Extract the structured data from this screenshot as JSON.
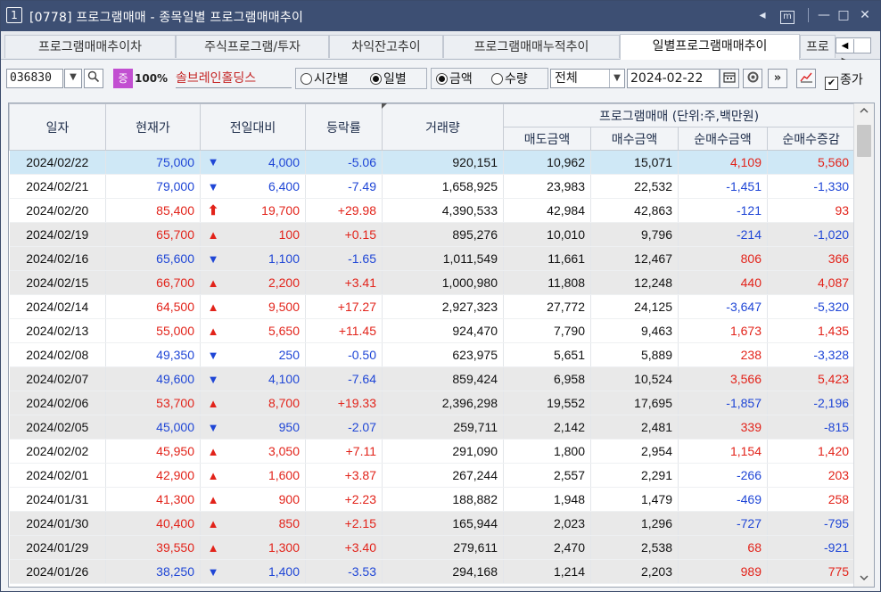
{
  "window": {
    "number": "1",
    "title": "[0778] 프로그램매매 - 종목일별 프로그램매매추이",
    "controls": {
      "left": "◂",
      "m": "m",
      "min": "—",
      "max": "□",
      "close": "✕"
    }
  },
  "tabs": [
    {
      "label": "프로그램매매추이차"
    },
    {
      "label": "주식프로그램/투자"
    },
    {
      "label": "차익잔고추이"
    },
    {
      "label": "프로그램매매누적추이"
    },
    {
      "label": "일별프로그램매매추이"
    },
    {
      "label": "프로"
    }
  ],
  "toolbar": {
    "code": "036830",
    "badge": "증",
    "margin": "100%",
    "stock_name": "솔브레인홀딩스",
    "radio_time": "시간별",
    "radio_day": "일별",
    "radio_amount": "금액",
    "radio_qty": "수량",
    "filter_value": "전체",
    "date": "2024-02-22",
    "chk_label": "종가"
  },
  "table": {
    "headers": {
      "date": "일자",
      "price": "현재가",
      "change": "전일대비",
      "rate": "등락률",
      "volume": "거래량",
      "group": "프로그램매매 (단위:주,백만원)",
      "sell": "매도금액",
      "buy": "매수금액",
      "net": "순매수금액",
      "net_chg": "순매수증감"
    },
    "rows": [
      {
        "date": "2024/02/22",
        "price": "75,000",
        "dir": "down",
        "change": "4,000",
        "rate": "-5.06",
        "volume": "920,151",
        "sell": "10,962",
        "buy": "15,071",
        "net": "4,109",
        "net_chg": "5,560"
      },
      {
        "date": "2024/02/21",
        "price": "79,000",
        "dir": "down",
        "change": "6,400",
        "rate": "-7.49",
        "volume": "1,658,925",
        "sell": "23,983",
        "buy": "22,532",
        "net": "-1,451",
        "net_chg": "-1,330"
      },
      {
        "date": "2024/02/20",
        "price": "85,400",
        "dir": "limit",
        "change": "19,700",
        "rate": "+29.98",
        "volume": "4,390,533",
        "sell": "42,984",
        "buy": "42,863",
        "net": "-121",
        "net_chg": "93"
      },
      {
        "date": "2024/02/19",
        "price": "65,700",
        "dir": "up",
        "change": "100",
        "rate": "+0.15",
        "volume": "895,276",
        "sell": "10,010",
        "buy": "9,796",
        "net": "-214",
        "net_chg": "-1,020"
      },
      {
        "date": "2024/02/16",
        "price": "65,600",
        "dir": "down",
        "change": "1,100",
        "rate": "-1.65",
        "volume": "1,011,549",
        "sell": "11,661",
        "buy": "12,467",
        "net": "806",
        "net_chg": "366"
      },
      {
        "date": "2024/02/15",
        "price": "66,700",
        "dir": "up",
        "change": "2,200",
        "rate": "+3.41",
        "volume": "1,000,980",
        "sell": "11,808",
        "buy": "12,248",
        "net": "440",
        "net_chg": "4,087"
      },
      {
        "date": "2024/02/14",
        "price": "64,500",
        "dir": "up",
        "change": "9,500",
        "rate": "+17.27",
        "volume": "2,927,323",
        "sell": "27,772",
        "buy": "24,125",
        "net": "-3,647",
        "net_chg": "-5,320"
      },
      {
        "date": "2024/02/13",
        "price": "55,000",
        "dir": "up",
        "change": "5,650",
        "rate": "+11.45",
        "volume": "924,470",
        "sell": "7,790",
        "buy": "9,463",
        "net": "1,673",
        "net_chg": "1,435"
      },
      {
        "date": "2024/02/08",
        "price": "49,350",
        "dir": "down",
        "change": "250",
        "rate": "-0.50",
        "volume": "623,975",
        "sell": "5,651",
        "buy": "5,889",
        "net": "238",
        "net_chg": "-3,328"
      },
      {
        "date": "2024/02/07",
        "price": "49,600",
        "dir": "down",
        "change": "4,100",
        "rate": "-7.64",
        "volume": "859,424",
        "sell": "6,958",
        "buy": "10,524",
        "net": "3,566",
        "net_chg": "5,423"
      },
      {
        "date": "2024/02/06",
        "price": "53,700",
        "dir": "up",
        "change": "8,700",
        "rate": "+19.33",
        "volume": "2,396,298",
        "sell": "19,552",
        "buy": "17,695",
        "net": "-1,857",
        "net_chg": "-2,196"
      },
      {
        "date": "2024/02/05",
        "price": "45,000",
        "dir": "down",
        "change": "950",
        "rate": "-2.07",
        "volume": "259,711",
        "sell": "2,142",
        "buy": "2,481",
        "net": "339",
        "net_chg": "-815"
      },
      {
        "date": "2024/02/02",
        "price": "45,950",
        "dir": "up",
        "change": "3,050",
        "rate": "+7.11",
        "volume": "291,090",
        "sell": "1,800",
        "buy": "2,954",
        "net": "1,154",
        "net_chg": "1,420"
      },
      {
        "date": "2024/02/01",
        "price": "42,900",
        "dir": "up",
        "change": "1,600",
        "rate": "+3.87",
        "volume": "267,244",
        "sell": "2,557",
        "buy": "2,291",
        "net": "-266",
        "net_chg": "203"
      },
      {
        "date": "2024/01/31",
        "price": "41,300",
        "dir": "up",
        "change": "900",
        "rate": "+2.23",
        "volume": "188,882",
        "sell": "1,948",
        "buy": "1,479",
        "net": "-469",
        "net_chg": "258"
      },
      {
        "date": "2024/01/30",
        "price": "40,400",
        "dir": "up",
        "change": "850",
        "rate": "+2.15",
        "volume": "165,944",
        "sell": "2,023",
        "buy": "1,296",
        "net": "-727",
        "net_chg": "-795"
      },
      {
        "date": "2024/01/29",
        "price": "39,550",
        "dir": "up",
        "change": "1,300",
        "rate": "+3.40",
        "volume": "279,611",
        "sell": "2,470",
        "buy": "2,538",
        "net": "68",
        "net_chg": "-921"
      },
      {
        "date": "2024/01/26",
        "price": "38,250",
        "dir": "down",
        "change": "1,400",
        "rate": "-3.53",
        "volume": "294,168",
        "sell": "1,214",
        "buy": "2,203",
        "net": "989",
        "net_chg": "775"
      }
    ],
    "row_styles": [
      "sel",
      "",
      "",
      "gray",
      "gray",
      "gray",
      "",
      "",
      "",
      "gray",
      "gray",
      "gray",
      "",
      "",
      "",
      "gray",
      "gray",
      "gray"
    ]
  },
  "colors": {
    "up": "#e2231a",
    "down": "#1f46d6",
    "title_bg": "#3d4f73",
    "selected_row": "#cfe8f6",
    "gray_row": "#e9e9e9"
  },
  "icons": [
    "dropdown-icon",
    "search-icon",
    "calendar-icon",
    "refresh-icon",
    "next-icon",
    "chart-icon",
    "checkbox-icon",
    "scroll-up-icon",
    "scroll-down-icon"
  ]
}
